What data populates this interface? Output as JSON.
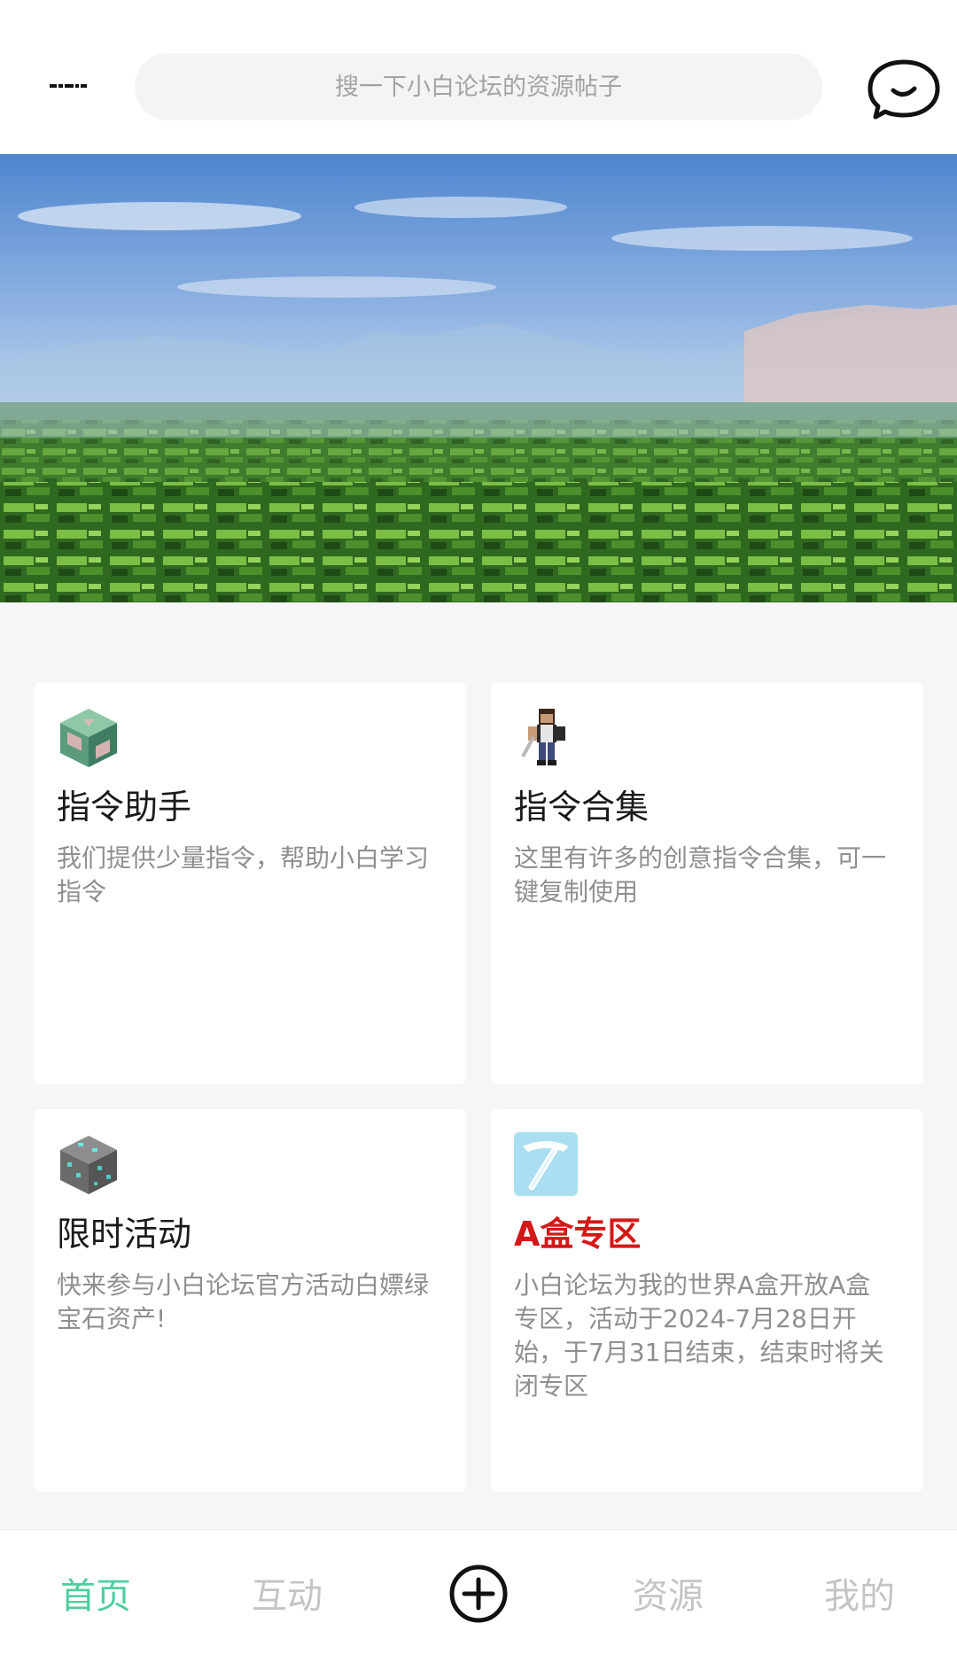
{
  "header": {
    "search_placeholder": "搜一下小白论坛的资源帖子",
    "message_icon": "message-bubble-icon"
  },
  "banner": {
    "image": "minecraft-forest-landscape"
  },
  "cards": [
    {
      "icon": "command-block-icon",
      "title": "指令助手",
      "description": "我们提供少量指令，帮助小白学习指令"
    },
    {
      "icon": "minecraft-character-icon",
      "title": "指令合集",
      "description": "这里有许多的创意指令合集，可一键复制使用"
    },
    {
      "icon": "diamond-ore-icon",
      "title": "限时活动",
      "description": "快来参与小白论坛官方活动白嫖绿宝石资产!"
    },
    {
      "icon": "diamond-pickaxe-icon",
      "title": "A盒专区",
      "title_color": "#d41818",
      "description": "小白论坛为我的世界A盒开放A盒专区，活动于2024-7月28日开始，于7月31日结束，结束时将关闭专区"
    }
  ],
  "bottom_nav": {
    "items": [
      {
        "label": "首页",
        "active": true
      },
      {
        "label": "互动",
        "active": false
      },
      {
        "label": "资源",
        "active": false
      },
      {
        "label": "我的",
        "active": false
      }
    ],
    "add_icon": "plus-circle-icon",
    "active_color": "#4ccf9d"
  }
}
